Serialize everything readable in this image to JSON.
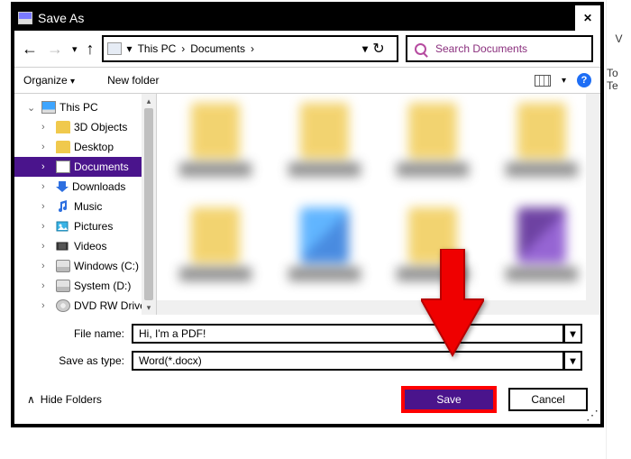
{
  "dialog": {
    "title": "Save As",
    "close": "✕"
  },
  "nav": {
    "back": "←",
    "forward": "→",
    "fdrop": "▾",
    "up": "↑",
    "refresh": "↻",
    "path_drop": "▾"
  },
  "breadcrumb": {
    "items": [
      "This PC",
      "Documents"
    ],
    "sep": "›"
  },
  "search": {
    "placeholder": "Search Documents"
  },
  "toolbar": {
    "organize": "Organize",
    "organize_drop": "▾",
    "newfolder": "New folder",
    "view_drop": "▾",
    "help": "?"
  },
  "tree": {
    "items": [
      {
        "label": "This PC",
        "icon": "pc",
        "depth": 1,
        "exp": "v"
      },
      {
        "label": "3D Objects",
        "icon": "folder",
        "depth": 2,
        "exp": ">"
      },
      {
        "label": "Desktop",
        "icon": "folder",
        "depth": 2,
        "exp": ">"
      },
      {
        "label": "Documents",
        "icon": "docpg",
        "depth": 2,
        "exp": ">",
        "selected": true
      },
      {
        "label": "Downloads",
        "icon": "dl",
        "depth": 2,
        "exp": ">"
      },
      {
        "label": "Music",
        "icon": "music",
        "depth": 2,
        "exp": ">"
      },
      {
        "label": "Pictures",
        "icon": "pic",
        "depth": 2,
        "exp": ">"
      },
      {
        "label": "Videos",
        "icon": "vid",
        "depth": 2,
        "exp": ">"
      },
      {
        "label": "Windows (C:)",
        "icon": "drive",
        "depth": 2,
        "exp": ">"
      },
      {
        "label": "System (D:)",
        "icon": "drive",
        "depth": 2,
        "exp": ">"
      },
      {
        "label": "DVD RW Drive",
        "icon": "disc",
        "depth": 2,
        "exp": ">"
      }
    ],
    "up": "▴",
    "down": "▾"
  },
  "fields": {
    "name_label": "File name:",
    "name_value": "Hi, I'm a PDF!",
    "type_label": "Save as type:",
    "type_value": "Word(*.docx)",
    "drop": "▾"
  },
  "footer": {
    "hide": "Hide Folders",
    "hide_icon": "∧",
    "save": "Save",
    "cancel": "Cancel"
  },
  "outside": {
    "v": "V",
    "tote": "To Te"
  }
}
